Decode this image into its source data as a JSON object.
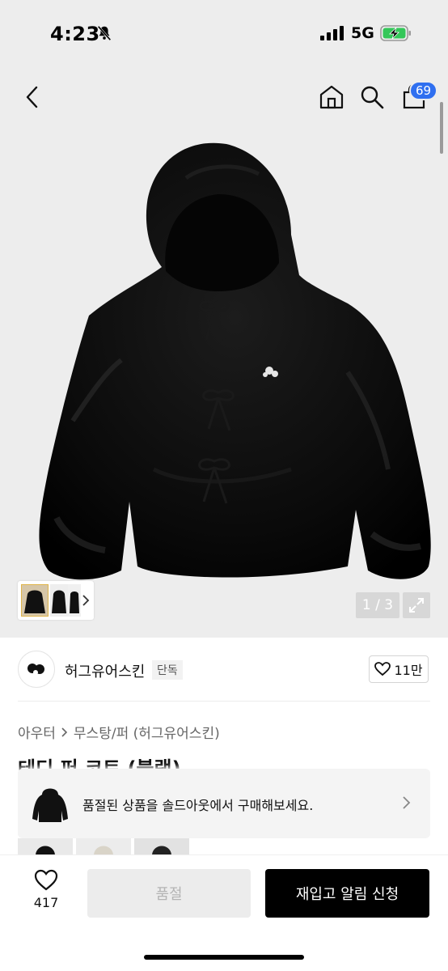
{
  "status_bar": {
    "time": "4:23",
    "network": "5G",
    "icons": [
      "bell-off-icon",
      "signal-icon",
      "battery-charging-icon"
    ]
  },
  "header": {
    "cart_badge": "69",
    "icons": [
      "back-icon",
      "home-icon",
      "search-icon",
      "cart-icon"
    ]
  },
  "gallery": {
    "counter": "1 / 3",
    "expand_icon": "expand-icon"
  },
  "brand": {
    "name": "허그유어스킨",
    "tag": "단독",
    "likes": "11만"
  },
  "breadcrumb": {
    "level1": "아우터",
    "level2": "무스탕/퍼 (허그유어스킨)"
  },
  "product": {
    "title": "테디 퍼 코트 (블랙)"
  },
  "soldout_banner": {
    "text": "품절된 상품을 솔드아웃에서 구매해보세요."
  },
  "bottom_bar": {
    "wish_count": "417",
    "soldout_label": "품절",
    "restock_label": "재입고 알림 신청"
  },
  "colors": {
    "accent_badge": "#2f6ff0",
    "primary_button": "#000000",
    "disabled_button": "#ececec",
    "image_bg": "#ededed"
  }
}
